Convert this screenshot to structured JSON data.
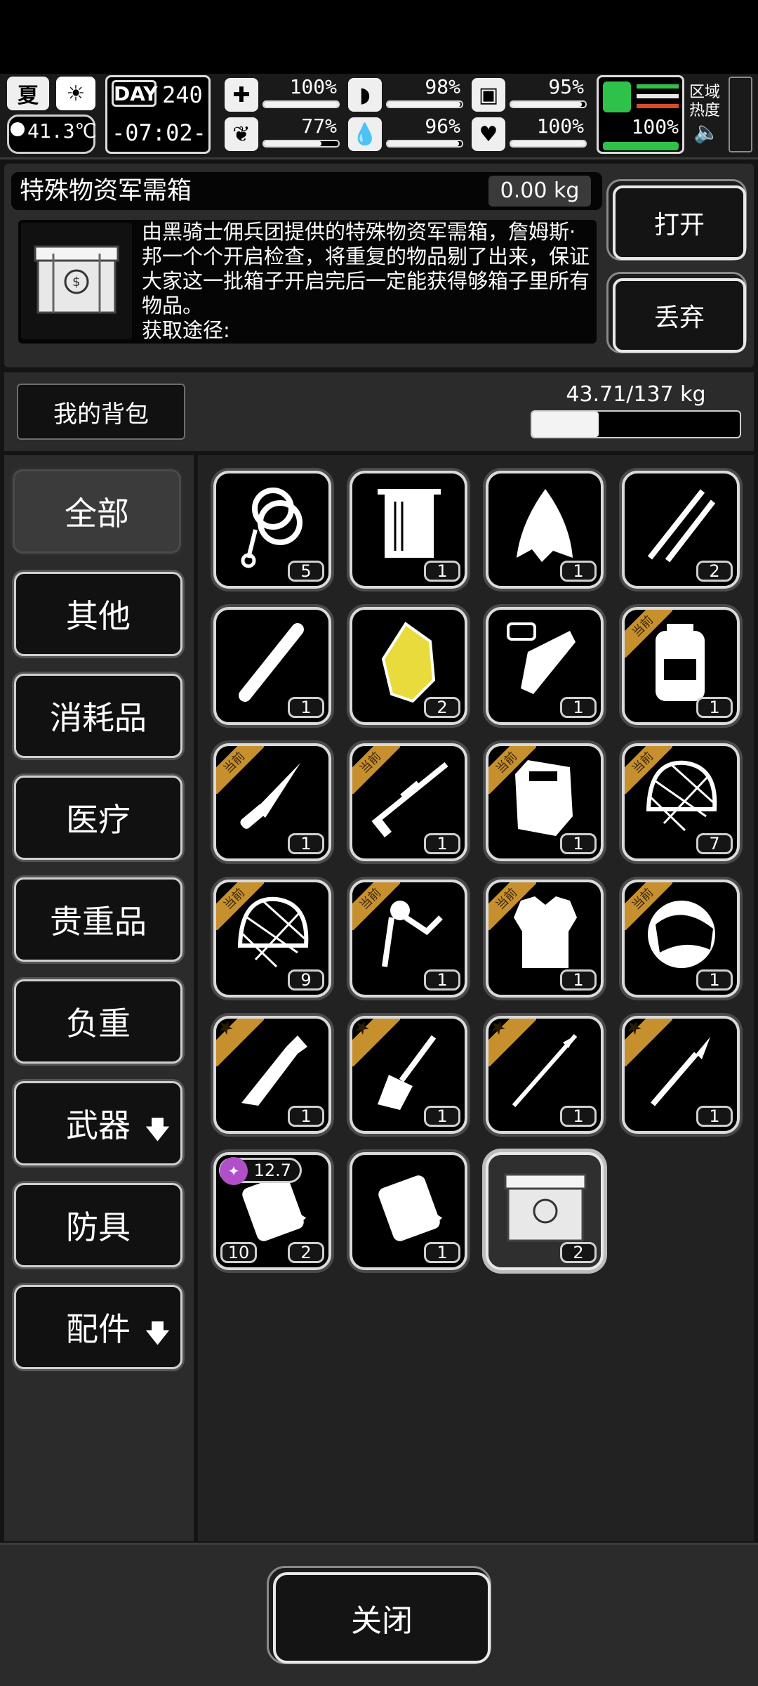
{
  "hud": {
    "season": "夏",
    "day_label": "DAY",
    "day_num": "240",
    "temperature": "41.3℃",
    "clock": "-07:02-",
    "stats": [
      {
        "icon": "medkit-icon",
        "pct": "100%",
        "fill": 1.0
      },
      {
        "icon": "stomach-icon",
        "pct": "98%",
        "fill": 0.98
      },
      {
        "icon": "lungs-icon",
        "pct": "95%",
        "fill": 0.95
      },
      {
        "icon": "brain-icon",
        "pct": "77%",
        "fill": 0.77
      },
      {
        "icon": "water-drop-icon",
        "pct": "96%",
        "fill": 0.96
      },
      {
        "icon": "heart-icon",
        "pct": "100%",
        "fill": 1.0
      }
    ],
    "stamina_pct": "100%",
    "zone_heat_label": "区域热度"
  },
  "item": {
    "name": "特殊物资军需箱",
    "weight": "0.00 kg",
    "description": "由黑骑士佣兵团提供的特殊物资军需箱，詹姆斯·邦一个个开启检查，将重复的物品剔了出来，保证大家这一批箱子开启完后一定能获得够箱子里所有物品。",
    "source_label": "获取途径:",
    "open_button": "打开",
    "discard_button": "丢弃"
  },
  "bag": {
    "title": "我的背包",
    "capacity": "43.71/137 kg",
    "capacity_fraction": 0.32
  },
  "categories": [
    {
      "label": "全部",
      "active": true
    },
    {
      "label": "其他"
    },
    {
      "label": "消耗品"
    },
    {
      "label": "医疗"
    },
    {
      "label": "贵重品"
    },
    {
      "label": "负重"
    },
    {
      "label": "武器",
      "arrow": "🡇"
    },
    {
      "label": "防具"
    },
    {
      "label": "配件",
      "arrow": "🡇"
    }
  ],
  "ribbon_text": "当前",
  "items": [
    {
      "icon": "rope-icon",
      "qty": "5"
    },
    {
      "icon": "towel-icon",
      "qty": "1"
    },
    {
      "icon": "torn-cloth-icon",
      "qty": "1"
    },
    {
      "icon": "lockpick-icon",
      "qty": "2"
    },
    {
      "icon": "stick-icon",
      "qty": "1"
    },
    {
      "icon": "gold-ore-icon",
      "qty": "2"
    },
    {
      "icon": "test-tube-icon",
      "qty": "1"
    },
    {
      "icon": "backpack-icon",
      "qty": "1",
      "ribbon": "current"
    },
    {
      "icon": "combat-knife-icon",
      "qty": "1",
      "ribbon": "current"
    },
    {
      "icon": "sniper-rifle-icon",
      "qty": "1",
      "ribbon": "current"
    },
    {
      "icon": "riot-shield-icon",
      "qty": "1",
      "ribbon": "current"
    },
    {
      "icon": "net-helmet-icon",
      "qty": "7",
      "ribbon": "current"
    },
    {
      "icon": "net-helmet-icon",
      "qty": "9",
      "ribbon": "current"
    },
    {
      "icon": "ornament-icon",
      "qty": "1",
      "ribbon": "current"
    },
    {
      "icon": "body-armor-icon",
      "qty": "1",
      "ribbon": "current"
    },
    {
      "icon": "visor-helmet-icon",
      "qty": "1",
      "ribbon": "current"
    },
    {
      "icon": "multitool-icon",
      "qty": "1",
      "ribbon": "star"
    },
    {
      "icon": "shovel-icon",
      "qty": "1",
      "ribbon": "star"
    },
    {
      "icon": "spear-icon",
      "qty": "1",
      "ribbon": "star"
    },
    {
      "icon": "scalpel-icon",
      "qty": "1",
      "ribbon": "star"
    },
    {
      "icon": "ammo-pack-icon",
      "qty": "2",
      "qty_left": "10",
      "caliber": "12.7"
    },
    {
      "icon": "ammo-pack-icon",
      "qty": "1"
    },
    {
      "icon": "supply-crate-icon",
      "qty": "2",
      "selected": true
    }
  ],
  "close_button": "关闭"
}
